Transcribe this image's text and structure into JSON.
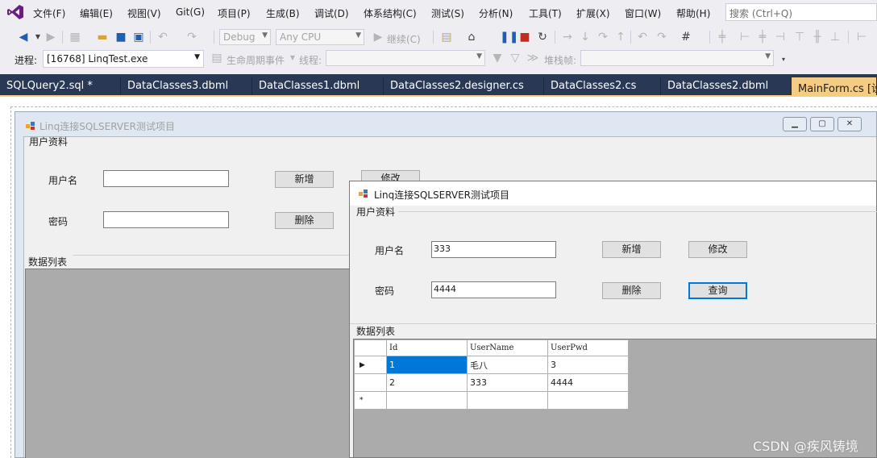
{
  "menubar": {
    "items": [
      "文件(F)",
      "编辑(E)",
      "视图(V)",
      "Git(G)",
      "项目(P)",
      "生成(B)",
      "调试(D)",
      "体系结构(C)",
      "测试(S)",
      "分析(N)",
      "工具(T)",
      "扩展(X)",
      "窗口(W)",
      "帮助(H)"
    ],
    "search_placeholder": "搜索 (Ctrl+Q)"
  },
  "toolbar": {
    "config": "Debug",
    "platform": "Any CPU",
    "continue_label": "继续(C)",
    "process_label": "进程:",
    "process_value": "[16768] LinqTest.exe",
    "lifecycle_label": "生命周期事件",
    "thread_label": "线程:",
    "stackframe_label": "堆栈帧:"
  },
  "tabs": [
    {
      "label": "SQLQuery2.sql *",
      "active": false
    },
    {
      "label": "DataClasses3.dbml",
      "active": false
    },
    {
      "label": "DataClasses1.dbml",
      "active": false
    },
    {
      "label": "DataClasses2.designer.cs",
      "active": false
    },
    {
      "label": "DataClasses2.cs",
      "active": false
    },
    {
      "label": "DataClasses2.dbml",
      "active": false
    },
    {
      "label": "MainForm.cs [设计]",
      "active": true
    }
  ],
  "design_form": {
    "title": "Linq连接SQLSERVER测试项目",
    "group_user": "用户资料",
    "username_label": "用户名",
    "password_label": "密码",
    "btn_add": "新增",
    "btn_edit": "修改",
    "btn_delete": "删除",
    "group_list": "数据列表"
  },
  "run_form": {
    "title": "Linq连接SQLSERVER测试项目",
    "group_user": "用户资料",
    "username_label": "用户名",
    "username_value": "333",
    "password_label": "密码",
    "password_value": "4444",
    "btn_add": "新增",
    "btn_edit": "修改",
    "btn_delete": "删除",
    "btn_query": "查询",
    "group_list": "数据列表",
    "grid": {
      "columns": [
        "Id",
        "UserName",
        "UserPwd"
      ],
      "rows": [
        {
          "marker": "▶",
          "Id": "1",
          "UserName": "毛八",
          "UserPwd": "3"
        },
        {
          "marker": "",
          "Id": "2",
          "UserName": "333",
          "UserPwd": "4444"
        },
        {
          "marker": "*",
          "Id": "",
          "UserName": "",
          "UserPwd": ""
        }
      ]
    }
  },
  "watermark": "CSDN @疾风铸境",
  "colors": {
    "tabbar": "#293955",
    "active_tab": "#f5cc84",
    "selection": "#0078d7"
  }
}
